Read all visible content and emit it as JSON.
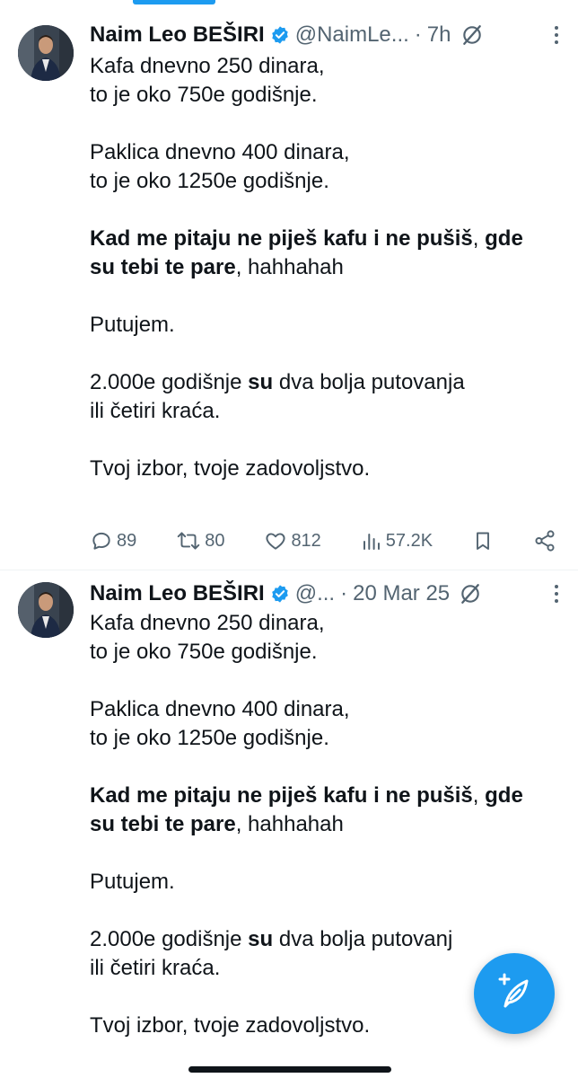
{
  "tweets": [
    {
      "author_name": "Naim Leo BEŠIRI",
      "handle": "@NaimLe...",
      "separator": "·",
      "time": "7h",
      "paragraphs": [
        [
          {
            "t": "Kafa dnevno 250 dinara,",
            "b": false
          }
        ],
        [
          {
            "t": "to je oko 750e godišnje.",
            "b": false
          }
        ],
        [
          {
            "t": "Paklica dnevno 400 dinara,",
            "b": false
          }
        ],
        [
          {
            "t": "to je oko 1250e godišnje.",
            "b": false
          }
        ],
        [
          {
            "t": "Kad me pitaju ne piješ kafu i ne pušiš",
            "b": true
          },
          {
            "t": ", ",
            "b": false
          },
          {
            "t": "gde",
            "b": true
          }
        ],
        [
          {
            "t": "su tebi te pare",
            "b": true
          },
          {
            "t": ", hahhahah",
            "b": false
          }
        ],
        [
          {
            "t": "Putujem.",
            "b": false
          }
        ],
        [
          {
            "t": "2.000e godišnje ",
            "b": false
          },
          {
            "t": "su",
            "b": true
          },
          {
            "t": " dva bolja putovanja",
            "b": false
          }
        ],
        [
          {
            "t": "ili četiri kraća.",
            "b": false
          }
        ],
        [
          {
            "t": "Tvoj izbor, tvoje zadovoljstvo.",
            "b": false
          }
        ]
      ],
      "replies": "89",
      "reposts": "80",
      "likes": "812",
      "views": "57.2K"
    },
    {
      "author_name": "Naim Leo BEŠIRI",
      "handle": "@...",
      "separator": "·",
      "time": "20 Mar 25",
      "paragraphs": [
        [
          {
            "t": "Kafa dnevno 250 dinara,",
            "b": false
          }
        ],
        [
          {
            "t": "to je oko 750e godišnje.",
            "b": false
          }
        ],
        [
          {
            "t": "Paklica dnevno 400 dinara,",
            "b": false
          }
        ],
        [
          {
            "t": "to je oko 1250e godišnje.",
            "b": false
          }
        ],
        [
          {
            "t": "Kad me pitaju ne piješ kafu i ne pušiš",
            "b": true
          },
          {
            "t": ", ",
            "b": false
          },
          {
            "t": "gde",
            "b": true
          }
        ],
        [
          {
            "t": "su tebi te pare",
            "b": true
          },
          {
            "t": ", hahhahah",
            "b": false
          }
        ],
        [
          {
            "t": "Putujem.",
            "b": false
          }
        ],
        [
          {
            "t": "2.000e godišnje ",
            "b": false
          },
          {
            "t": "su",
            "b": true
          },
          {
            "t": " dva bolja putovanj",
            "b": false
          }
        ],
        [
          {
            "t": "ili četiri kraća.",
            "b": false
          }
        ],
        [
          {
            "t": "Tvoj izbor, tvoje zadovoljstvo.",
            "b": false
          }
        ]
      ]
    }
  ],
  "icons": {
    "verified": "verified-badge-icon",
    "grok": "grok-icon",
    "more": "more-icon",
    "reply": "reply-icon",
    "repost": "repost-icon",
    "like": "like-icon",
    "views": "views-icon",
    "bookmark": "bookmark-icon",
    "share": "share-icon",
    "compose": "compose-icon"
  },
  "colors": {
    "accent": "#1d9bf0",
    "text": "#0f1419",
    "secondary": "#536471",
    "divider": "#eff3f4"
  }
}
